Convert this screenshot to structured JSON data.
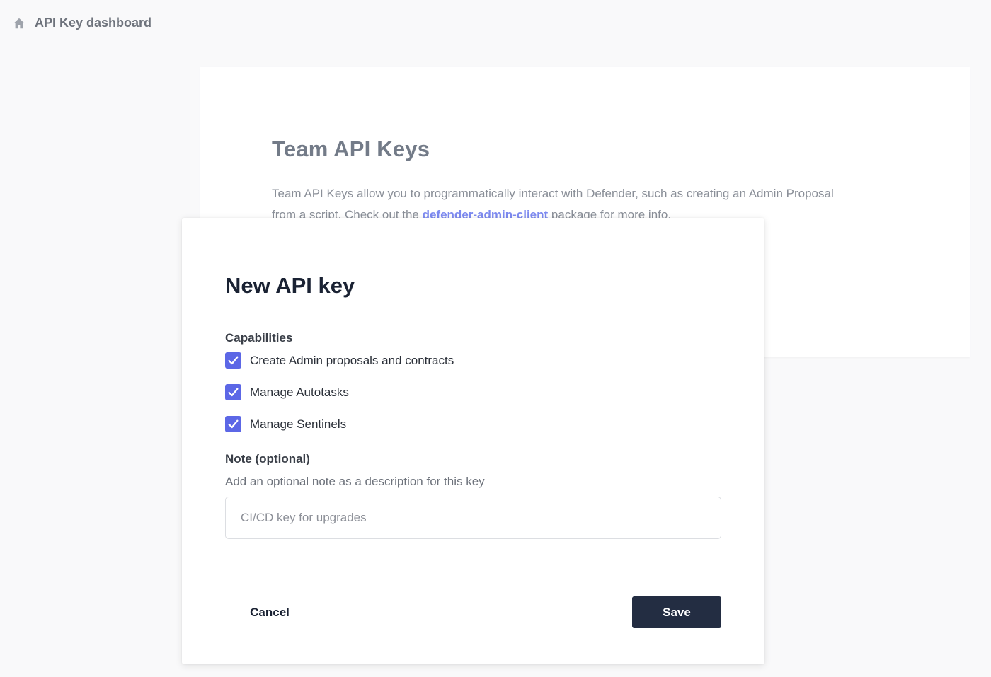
{
  "breadcrumb": {
    "icon": "home-icon",
    "label": "API Key dashboard"
  },
  "background_card": {
    "title": "Team API Keys",
    "description_before": "Team API Keys allow you to programmatically interact with Defender, such as creating an Admin Proposal from a script. Check out the ",
    "description_link": "defender-admin-client",
    "description_after": " package for more info."
  },
  "modal": {
    "title": "New API key",
    "capabilities_label": "Capabilities",
    "capabilities": [
      {
        "label": "Create Admin proposals and contracts",
        "checked": true
      },
      {
        "label": "Manage Autotasks",
        "checked": true
      },
      {
        "label": "Manage Sentinels",
        "checked": true
      }
    ],
    "note_label": "Note (optional)",
    "note_help": "Add an optional note as a description for this key",
    "note_value": "",
    "note_placeholder": "CI/CD key for upgrades",
    "cancel_label": "Cancel",
    "save_label": "Save"
  },
  "colors": {
    "accent": "#5c67e6",
    "link": "#7d8af0",
    "primary_button": "#232d42"
  }
}
